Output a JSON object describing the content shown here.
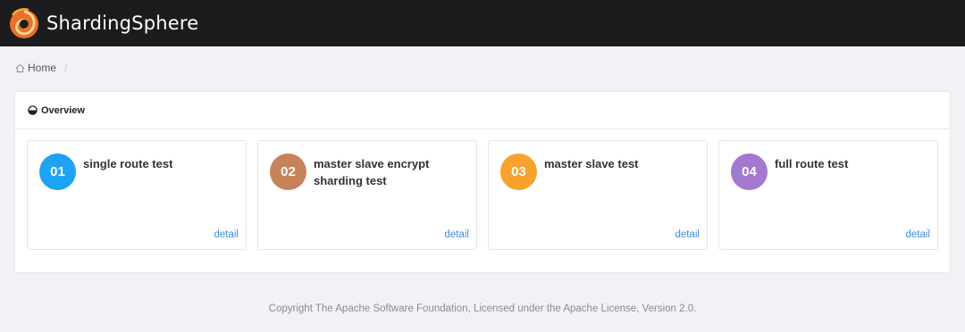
{
  "header": {
    "brand": "ShardingSphere",
    "logo_icon": "flame-swirl-logo",
    "bg_color": "#1c1c1e"
  },
  "breadcrumb": {
    "home_label": "Home",
    "separator": "/"
  },
  "overview": {
    "title": "Overview",
    "cards": [
      {
        "number": "01",
        "title": "single route test",
        "link": "detail",
        "color": "#1ea3f2"
      },
      {
        "number": "02",
        "title": "master slave encrypt sharding test",
        "link": "detail",
        "color": "#c8825a"
      },
      {
        "number": "03",
        "title": "master slave test",
        "link": "detail",
        "color": "#f7a22d"
      },
      {
        "number": "04",
        "title": "full route test",
        "link": "detail",
        "color": "#a378cf"
      }
    ]
  },
  "footer": {
    "text": "Copyright The Apache Software Foundation, Licensed under the Apache License, Version 2.0."
  }
}
